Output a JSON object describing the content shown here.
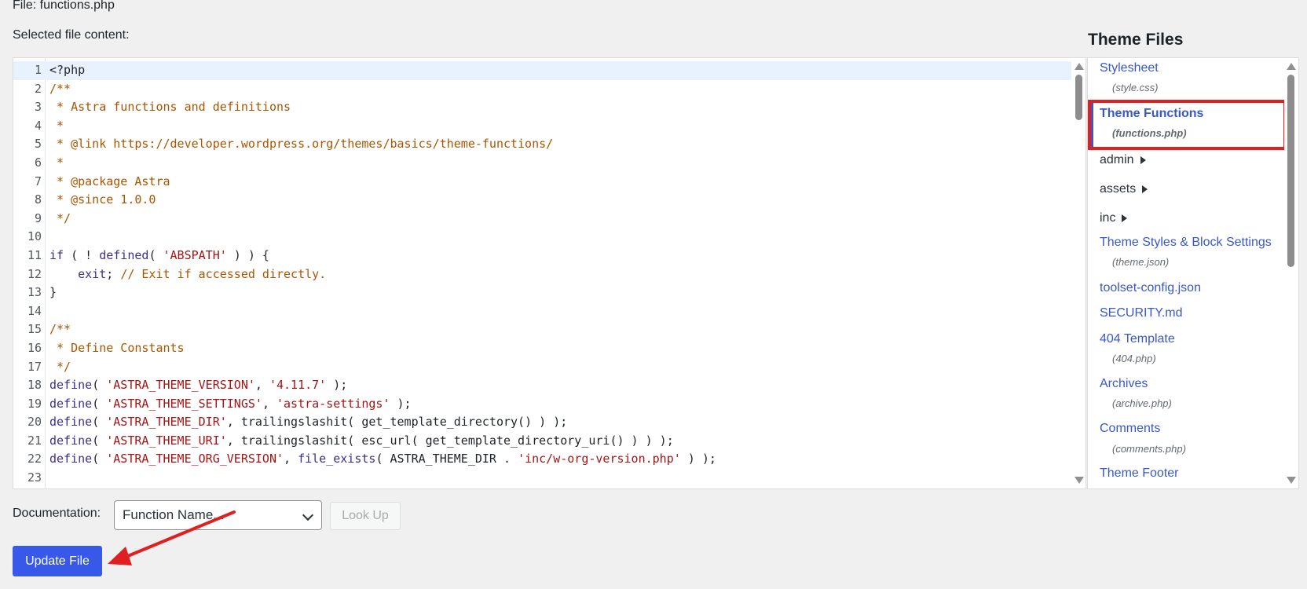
{
  "header": {
    "file_label": "File: functions.php",
    "selected_content_label": "Selected file content:",
    "theme_files_title": "Theme Files"
  },
  "editor": {
    "lines": [
      {
        "n": "1",
        "active": true,
        "tokens": [
          {
            "t": "<?php",
            "c": "plain"
          }
        ]
      },
      {
        "n": "2",
        "tokens": [
          {
            "t": "/**",
            "c": "cmt"
          }
        ]
      },
      {
        "n": "3",
        "tokens": [
          {
            "t": " * Astra functions and definitions",
            "c": "cmt"
          }
        ]
      },
      {
        "n": "4",
        "tokens": [
          {
            "t": " *",
            "c": "cmt"
          }
        ]
      },
      {
        "n": "5",
        "tokens": [
          {
            "t": " * @link https://developer.wordpress.org/themes/basics/theme-functions/",
            "c": "cmt"
          }
        ]
      },
      {
        "n": "6",
        "tokens": [
          {
            "t": " *",
            "c": "cmt"
          }
        ]
      },
      {
        "n": "7",
        "tokens": [
          {
            "t": " * @package Astra",
            "c": "cmt"
          }
        ]
      },
      {
        "n": "8",
        "tokens": [
          {
            "t": " * @since 1.0.0",
            "c": "cmt"
          }
        ]
      },
      {
        "n": "9",
        "tokens": [
          {
            "t": " */",
            "c": "cmt"
          }
        ]
      },
      {
        "n": "10",
        "tokens": []
      },
      {
        "n": "11",
        "tokens": [
          {
            "t": "if",
            "c": "kw"
          },
          {
            "t": " ( ! ",
            "c": "plain"
          },
          {
            "t": "defined",
            "c": "kw"
          },
          {
            "t": "( ",
            "c": "plain"
          },
          {
            "t": "'ABSPATH'",
            "c": "str"
          },
          {
            "t": " ) ) {",
            "c": "plain"
          }
        ]
      },
      {
        "n": "12",
        "tokens": [
          {
            "t": "    ",
            "c": "plain"
          },
          {
            "t": "exit",
            "c": "kw"
          },
          {
            "t": "; ",
            "c": "plain"
          },
          {
            "t": "// Exit if accessed directly.",
            "c": "cmt"
          }
        ]
      },
      {
        "n": "13",
        "tokens": [
          {
            "t": "}",
            "c": "plain"
          }
        ]
      },
      {
        "n": "14",
        "tokens": []
      },
      {
        "n": "15",
        "tokens": [
          {
            "t": "/**",
            "c": "cmt"
          }
        ]
      },
      {
        "n": "16",
        "tokens": [
          {
            "t": " * Define Constants",
            "c": "cmt"
          }
        ]
      },
      {
        "n": "17",
        "tokens": [
          {
            "t": " */",
            "c": "cmt"
          }
        ]
      },
      {
        "n": "18",
        "tokens": [
          {
            "t": "define",
            "c": "kw"
          },
          {
            "t": "( ",
            "c": "plain"
          },
          {
            "t": "'ASTRA_THEME_VERSION'",
            "c": "str"
          },
          {
            "t": ", ",
            "c": "plain"
          },
          {
            "t": "'4.11.7'",
            "c": "str"
          },
          {
            "t": " );",
            "c": "plain"
          }
        ]
      },
      {
        "n": "19",
        "tokens": [
          {
            "t": "define",
            "c": "kw"
          },
          {
            "t": "( ",
            "c": "plain"
          },
          {
            "t": "'ASTRA_THEME_SETTINGS'",
            "c": "str"
          },
          {
            "t": ", ",
            "c": "plain"
          },
          {
            "t": "'astra-settings'",
            "c": "str"
          },
          {
            "t": " );",
            "c": "plain"
          }
        ]
      },
      {
        "n": "20",
        "tokens": [
          {
            "t": "define",
            "c": "kw"
          },
          {
            "t": "( ",
            "c": "plain"
          },
          {
            "t": "'ASTRA_THEME_DIR'",
            "c": "str"
          },
          {
            "t": ", trailingslashit( get_template_directory() ) );",
            "c": "plain"
          }
        ]
      },
      {
        "n": "21",
        "tokens": [
          {
            "t": "define",
            "c": "kw"
          },
          {
            "t": "( ",
            "c": "plain"
          },
          {
            "t": "'ASTRA_THEME_URI'",
            "c": "str"
          },
          {
            "t": ", trailingslashit( esc_url( get_template_directory_uri() ) ) );",
            "c": "plain"
          }
        ]
      },
      {
        "n": "22",
        "tokens": [
          {
            "t": "define",
            "c": "kw"
          },
          {
            "t": "( ",
            "c": "plain"
          },
          {
            "t": "'ASTRA_THEME_ORG_VERSION'",
            "c": "str"
          },
          {
            "t": ", ",
            "c": "plain"
          },
          {
            "t": "file_exists",
            "c": "kw"
          },
          {
            "t": "( ASTRA_THEME_DIR . ",
            "c": "plain"
          },
          {
            "t": "'inc/w-org-version.php'",
            "c": "str"
          },
          {
            "t": " ) );",
            "c": "plain"
          }
        ]
      },
      {
        "n": "23",
        "tokens": []
      }
    ]
  },
  "sidebar": {
    "stylesheet": {
      "label": "Stylesheet",
      "file": "(style.css)"
    },
    "theme_functions": {
      "label": "Theme Functions",
      "file": "(functions.php)"
    },
    "folders": [
      "admin",
      "assets",
      "inc"
    ],
    "theme_styles": {
      "label": "Theme Styles & Block Settings",
      "file": "(theme.json)"
    },
    "toolset_config": "toolset-config.json",
    "security": "SECURITY.md",
    "template_404": {
      "label": "404 Template",
      "file": "(404.php)"
    },
    "archives": {
      "label": "Archives",
      "file": "(archive.php)"
    },
    "comments": {
      "label": "Comments",
      "file": "(comments.php)"
    },
    "theme_footer": "Theme Footer"
  },
  "documentation": {
    "label": "Documentation:",
    "select_value": "Function Name...",
    "lookup_label": "Look Up"
  },
  "update_button_label": "Update File",
  "colors": {
    "accent": "#3858e9",
    "link": "#3858c8",
    "highlight": "#e02020"
  }
}
